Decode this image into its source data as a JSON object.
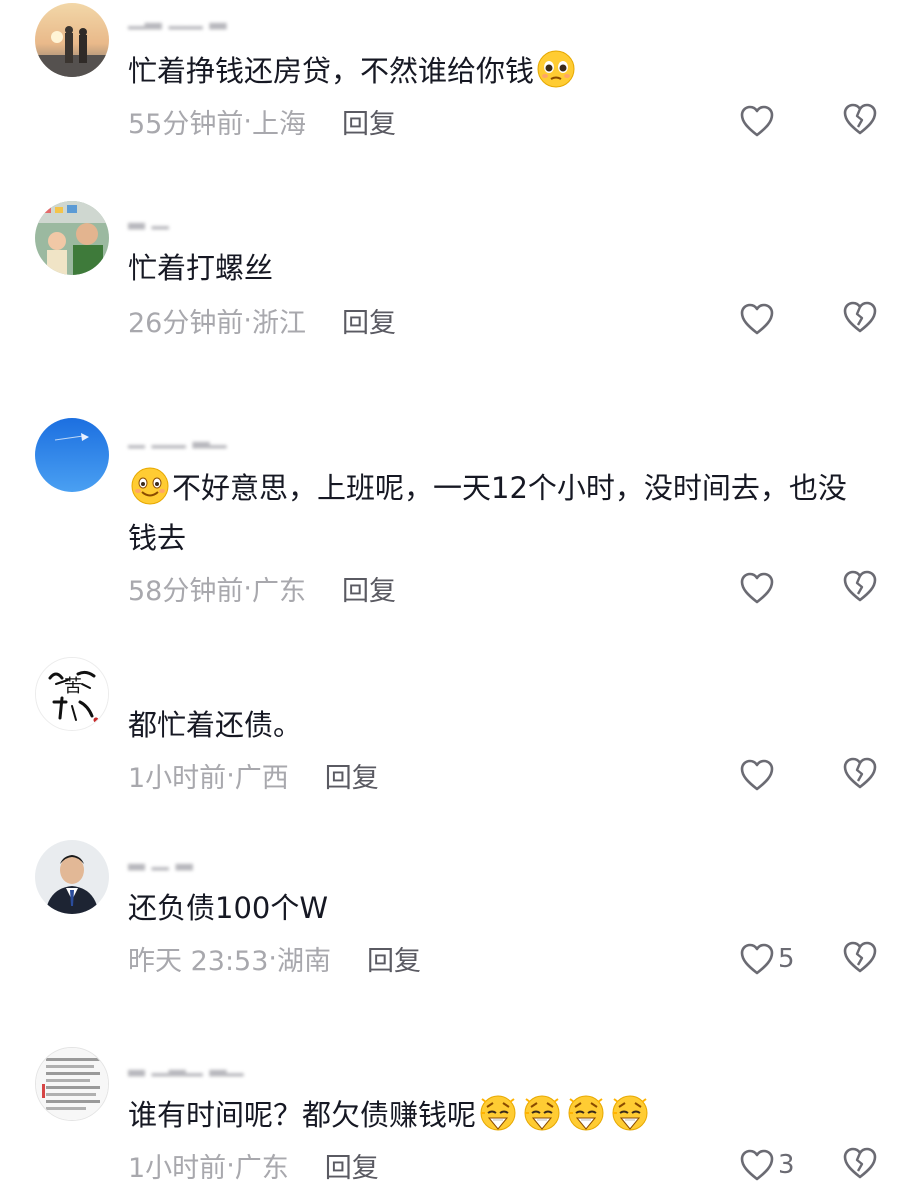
{
  "comments": [
    {
      "text": "忙着挣钱还房贷，不然谁给你钱",
      "emoji": "pleading-face-emoji",
      "time": "55分钟前",
      "location": "上海",
      "reply": "回复"
    },
    {
      "text": "忙着打螺丝",
      "time": "26分钟前",
      "location": "浙江",
      "reply": "回复"
    },
    {
      "emoji": "smiling-face-emoji",
      "text": "不好意思，上班呢，一天12个小时，没时间去，也没钱去",
      "time": "58分钟前",
      "location": "广东",
      "reply": "回复"
    },
    {
      "avatar_text": "苦尽甘来",
      "text": "都忙着还债。",
      "time": "1小时前",
      "location": "广西",
      "reply": "回复"
    },
    {
      "text": "还负债100个W",
      "time": "昨天 23:53",
      "location": "湖南",
      "reply": "回复",
      "likes": "5"
    },
    {
      "text": "谁有时间呢？都欠债赚钱呢",
      "emoji": "money-mouth-emoji",
      "time": "1小时前",
      "location": "广东",
      "reply": "回复",
      "likes": "3"
    }
  ],
  "separator": "·",
  "colors": {
    "text": "#161823",
    "meta": "#a8a8ad",
    "reply": "#5a5a62",
    "icon": "#6b6b73"
  }
}
